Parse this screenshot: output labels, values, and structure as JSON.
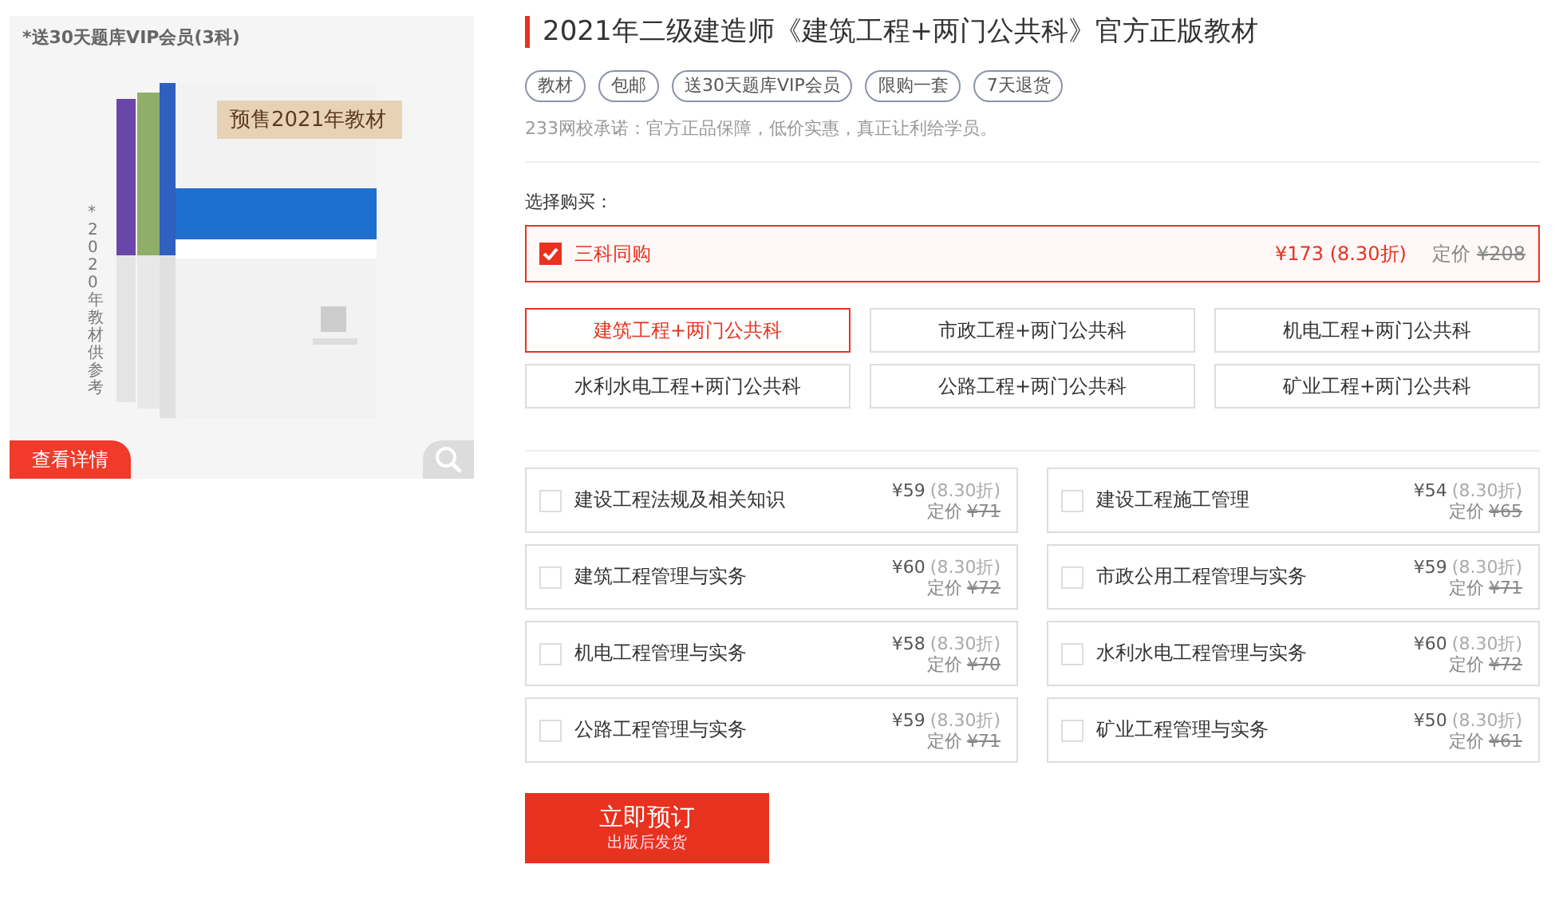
{
  "gallery": {
    "caption": "*送30天题库VIP会员(3科)",
    "banner": "预售2021年教材",
    "side_note": "*2020年教材供参考",
    "details_button": "查看详情"
  },
  "product": {
    "title": "2021年二级建造师《建筑工程+两门公共科》官方正版教材",
    "tags": [
      "教材",
      "包邮",
      "送30天题库VIP会员",
      "限购一套",
      "7天退货"
    ],
    "promise": "233网校承诺：官方正品保障，低价实惠，真正让利给学员。"
  },
  "purchase": {
    "label": "选择购买：",
    "bundle": {
      "name": "三科同购",
      "price": "¥173 (8.30折)",
      "list_label": "定价",
      "list_price": "¥208",
      "checked": true
    },
    "options": [
      {
        "label": "建筑工程+两门公共科",
        "selected": true
      },
      {
        "label": "市政工程+两门公共科",
        "selected": false
      },
      {
        "label": "机电工程+两门公共科",
        "selected": false
      },
      {
        "label": "水利水电工程+两门公共科",
        "selected": false
      },
      {
        "label": "公路工程+两门公共科",
        "selected": false
      },
      {
        "label": "矿业工程+两门公共科",
        "selected": false
      }
    ],
    "subjects": [
      {
        "name": "建设工程法规及相关知识",
        "price": "¥59",
        "discount": "(8.30折)",
        "list_label": "定价",
        "list_price": "¥71",
        "checked": false
      },
      {
        "name": "建设工程施工管理",
        "price": "¥54",
        "discount": "(8.30折)",
        "list_label": "定价",
        "list_price": "¥65",
        "checked": false
      },
      {
        "name": "建筑工程管理与实务",
        "price": "¥60",
        "discount": "(8.30折)",
        "list_label": "定价",
        "list_price": "¥72",
        "checked": false
      },
      {
        "name": "市政公用工程管理与实务",
        "price": "¥59",
        "discount": "(8.30折)",
        "list_label": "定价",
        "list_price": "¥71",
        "checked": false
      },
      {
        "name": "机电工程管理与实务",
        "price": "¥58",
        "discount": "(8.30折)",
        "list_label": "定价",
        "list_price": "¥70",
        "checked": false
      },
      {
        "name": "水利水电工程管理与实务",
        "price": "¥60",
        "discount": "(8.30折)",
        "list_label": "定价",
        "list_price": "¥72",
        "checked": false
      },
      {
        "name": "公路工程管理与实务",
        "price": "¥59",
        "discount": "(8.30折)",
        "list_label": "定价",
        "list_price": "¥71",
        "checked": false
      },
      {
        "name": "矿业工程管理与实务",
        "price": "¥50",
        "discount": "(8.30折)",
        "list_label": "定价",
        "list_price": "¥61",
        "checked": false
      }
    ],
    "order_button": {
      "label": "立即预订",
      "note": "出版后发货"
    }
  }
}
